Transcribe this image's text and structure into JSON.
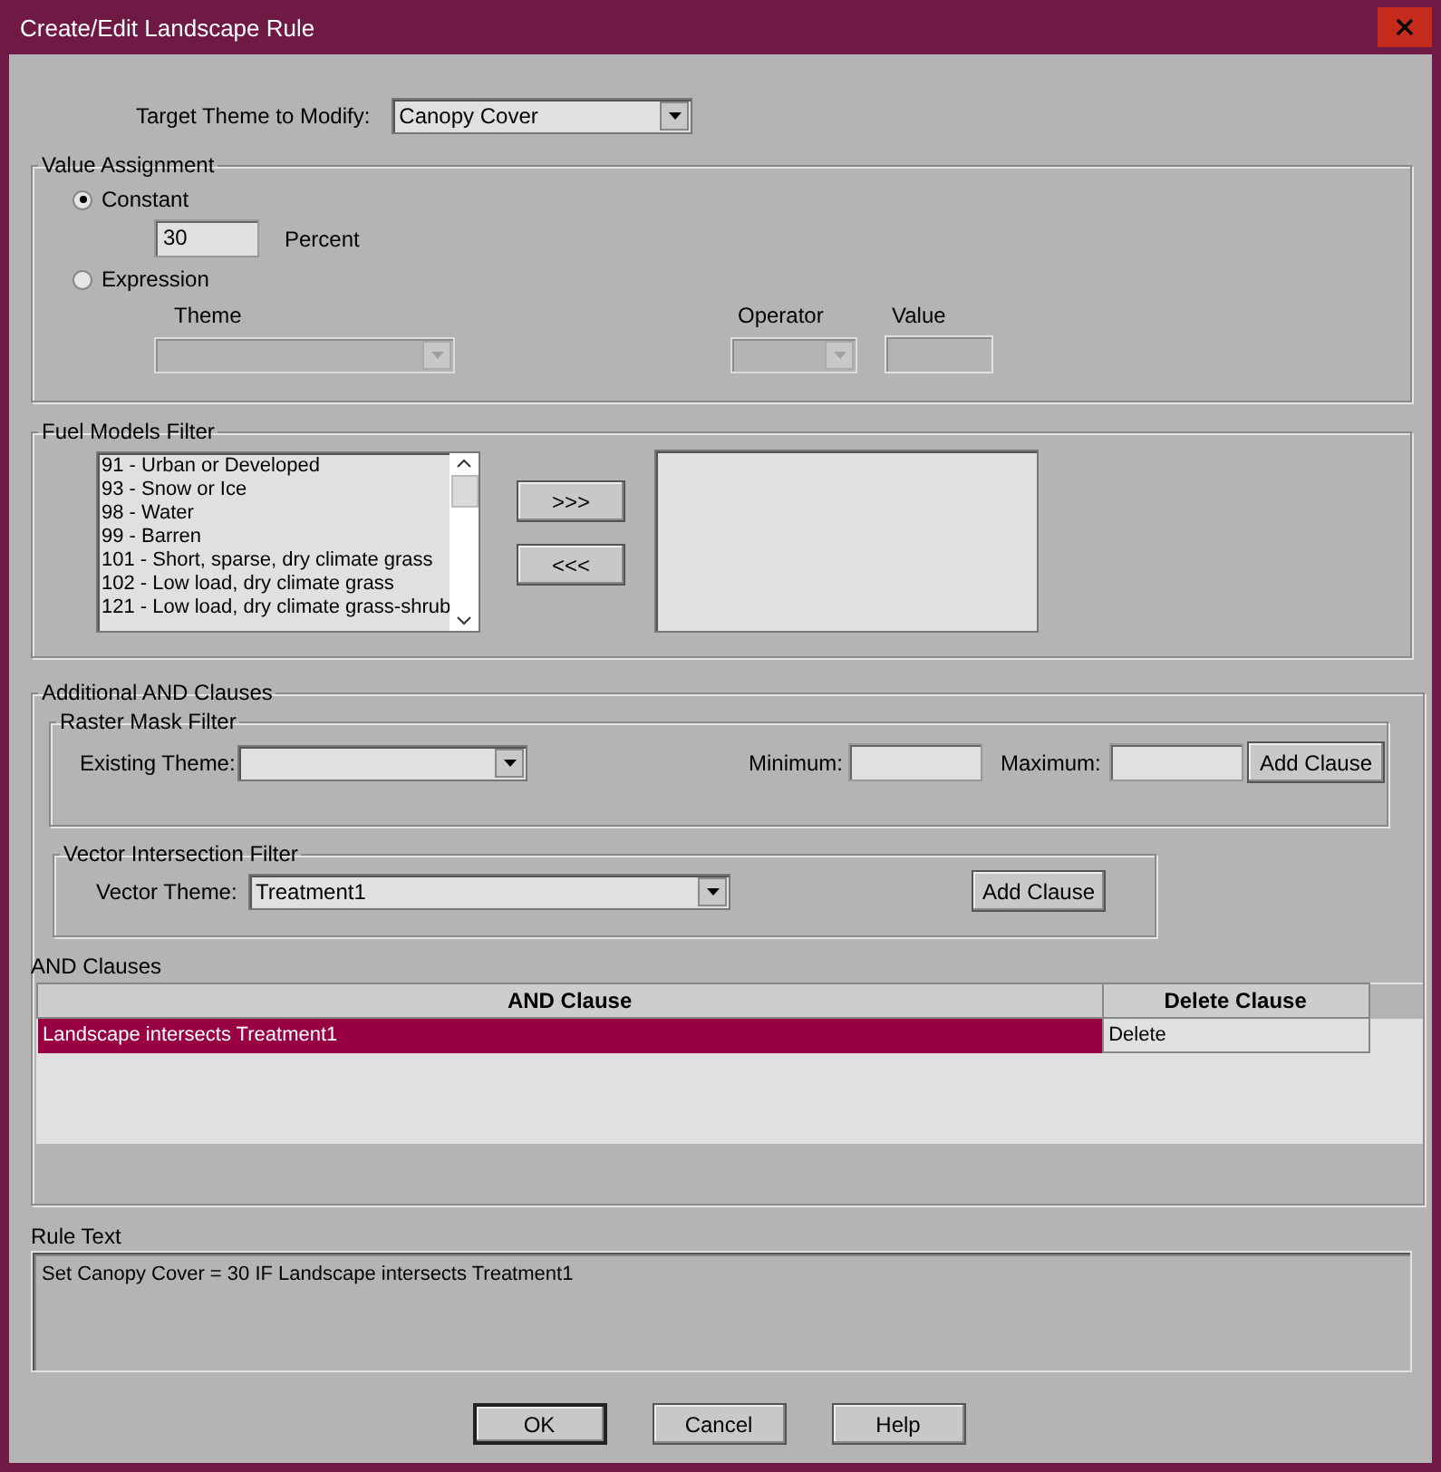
{
  "window": {
    "title": "Create/Edit Landscape Rule"
  },
  "target_theme": {
    "label": "Target Theme to Modify:",
    "value": "Canopy Cover"
  },
  "value_assignment": {
    "title": "Value Assignment",
    "options": [
      {
        "label": "Constant",
        "selected": true
      },
      {
        "label": "Expression",
        "selected": false
      }
    ],
    "constant_value": "30",
    "unit": "Percent",
    "expression": {
      "disabled": true,
      "theme_label": "Theme",
      "operator_label": "Operator",
      "value_label": "Value"
    }
  },
  "fuel_models_filter": {
    "title": "Fuel Models Filter",
    "available": [
      "91 - Urban or Developed",
      "93 - Snow or Ice",
      "98 - Water",
      "99 - Barren",
      "101 - Short, sparse, dry climate grass",
      "102 - Low load, dry climate grass",
      "121 - Low load, dry climate grass-shrub"
    ],
    "add_button": ">>>",
    "remove_button": "<<<"
  },
  "additional_and_clauses": {
    "title": "Additional AND Clauses",
    "raster_mask_filter": {
      "title": "Raster Mask Filter",
      "theme_label": "Existing Theme:",
      "minimum_label": "Minimum:",
      "maximum_label": "Maximum:",
      "button": "Add Clause"
    },
    "vector_intersection_filter": {
      "title": "Vector Intersection Filter",
      "theme_label": "Vector Theme:",
      "value": "Treatment1",
      "button": "Add Clause"
    },
    "and_clauses": {
      "title": "AND Clauses",
      "columns": [
        "AND Clause",
        "Delete Clause"
      ],
      "rows": [
        {
          "clause": "Landscape intersects Treatment1",
          "action": "Delete",
          "selected": true
        }
      ]
    }
  },
  "rule_text": {
    "label": "Rule Text",
    "value": "Set Canopy Cover = 30 IF Landscape intersects Treatment1"
  },
  "buttons": [
    "OK",
    "Cancel",
    "Help"
  ]
}
